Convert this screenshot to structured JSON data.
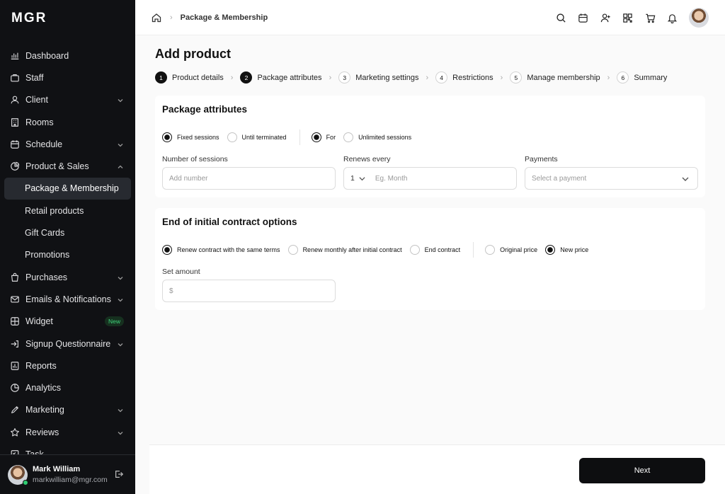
{
  "app": {
    "logo": "MGR"
  },
  "sidebar": {
    "items": [
      {
        "label": "Dashboard",
        "icon": "dashboard-icon"
      },
      {
        "label": "Staff",
        "icon": "briefcase-icon"
      },
      {
        "label": "Client",
        "icon": "user-icon",
        "expandable": true
      },
      {
        "label": "Rooms",
        "icon": "building-icon"
      },
      {
        "label": "Schedule",
        "icon": "calendar-icon",
        "expandable": true
      },
      {
        "label": "Product & Sales",
        "icon": "pie-icon",
        "expanded": true
      },
      {
        "label": "Package & Membership",
        "sub": true,
        "active": true
      },
      {
        "label": "Retail products",
        "sub": true
      },
      {
        "label": "Gift Cards",
        "sub": true
      },
      {
        "label": "Promotions",
        "sub": true
      },
      {
        "label": "Purchases",
        "icon": "bag-icon",
        "expandable": true
      },
      {
        "label": "Emails & Notifications",
        "icon": "mail-icon",
        "expandable": true
      },
      {
        "label": "Widget",
        "icon": "widget-icon",
        "badge": "New"
      },
      {
        "label": "Signup Questionnaire",
        "icon": "signup-icon",
        "expandable": true
      },
      {
        "label": "Reports",
        "icon": "reports-icon"
      },
      {
        "label": "Analytics",
        "icon": "analytics-icon"
      },
      {
        "label": "Marketing",
        "icon": "marketing-icon",
        "expandable": true
      },
      {
        "label": "Reviews",
        "icon": "star-icon",
        "expandable": true
      },
      {
        "label": "Task",
        "icon": "task-icon"
      }
    ],
    "user": {
      "name": "Mark William",
      "email": "markwilliam@mgr.com"
    }
  },
  "header": {
    "breadcrumb": "Package & Membership"
  },
  "page": {
    "title": "Add product",
    "steps": [
      {
        "num": "1",
        "label": "Product details",
        "done": true
      },
      {
        "num": "2",
        "label": "Package attributes",
        "done": true
      },
      {
        "num": "3",
        "label": "Marketing settings"
      },
      {
        "num": "4",
        "label": "Restrictions"
      },
      {
        "num": "5",
        "label": "Manage membership"
      },
      {
        "num": "6",
        "label": "Summary"
      }
    ],
    "package": {
      "title": "Package attributes",
      "radios1": [
        {
          "label": "Fixed sessions",
          "on": true
        },
        {
          "label": "Until terminated"
        }
      ],
      "radios2": [
        {
          "label": "For",
          "on": true
        },
        {
          "label": "Unlimited sessions"
        }
      ],
      "sessions_label": "Number of sessions",
      "sessions_placeholder": "Add number",
      "renews_label": "Renews every",
      "renews_value": "1",
      "renews_placeholder": "Eg. Month",
      "payments_label": "Payments",
      "payments_placeholder": "Select a payment"
    },
    "contract": {
      "title": "End of initial contract options",
      "radios1": [
        {
          "label": "Renew contract with the same terms",
          "on": true
        },
        {
          "label": "Renew monthly after initial contract"
        },
        {
          "label": "End contract"
        }
      ],
      "radios2": [
        {
          "label": "Original price"
        },
        {
          "label": "New price",
          "on": true
        }
      ],
      "amount_label": "Set amount",
      "amount_prefix": "$"
    },
    "next_label": "Next"
  }
}
